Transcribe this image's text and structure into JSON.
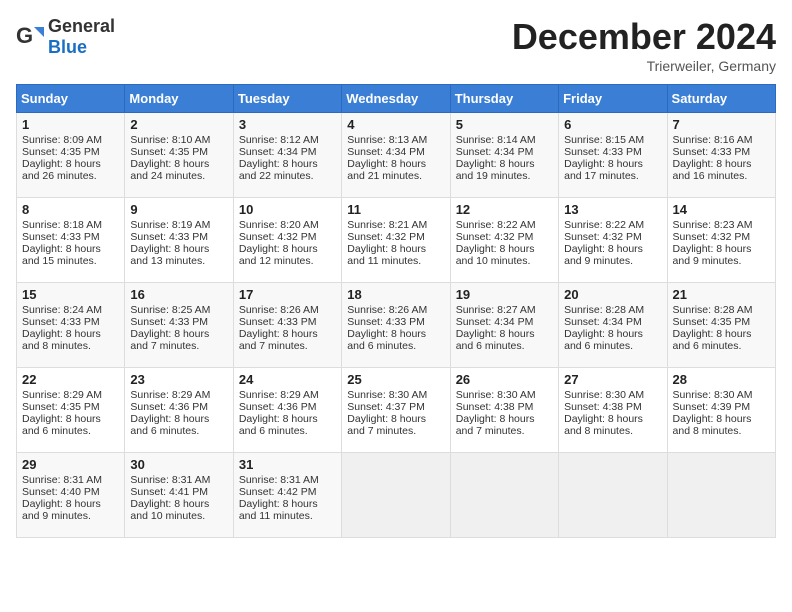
{
  "header": {
    "logo_general": "General",
    "logo_blue": "Blue",
    "month_title": "December 2024",
    "location": "Trierweiler, Germany"
  },
  "days_of_week": [
    "Sunday",
    "Monday",
    "Tuesday",
    "Wednesday",
    "Thursday",
    "Friday",
    "Saturday"
  ],
  "weeks": [
    [
      {
        "day": "1",
        "sunrise": "Sunrise: 8:09 AM",
        "sunset": "Sunset: 4:35 PM",
        "daylight": "Daylight: 8 hours and 26 minutes."
      },
      {
        "day": "2",
        "sunrise": "Sunrise: 8:10 AM",
        "sunset": "Sunset: 4:35 PM",
        "daylight": "Daylight: 8 hours and 24 minutes."
      },
      {
        "day": "3",
        "sunrise": "Sunrise: 8:12 AM",
        "sunset": "Sunset: 4:34 PM",
        "daylight": "Daylight: 8 hours and 22 minutes."
      },
      {
        "day": "4",
        "sunrise": "Sunrise: 8:13 AM",
        "sunset": "Sunset: 4:34 PM",
        "daylight": "Daylight: 8 hours and 21 minutes."
      },
      {
        "day": "5",
        "sunrise": "Sunrise: 8:14 AM",
        "sunset": "Sunset: 4:34 PM",
        "daylight": "Daylight: 8 hours and 19 minutes."
      },
      {
        "day": "6",
        "sunrise": "Sunrise: 8:15 AM",
        "sunset": "Sunset: 4:33 PM",
        "daylight": "Daylight: 8 hours and 17 minutes."
      },
      {
        "day": "7",
        "sunrise": "Sunrise: 8:16 AM",
        "sunset": "Sunset: 4:33 PM",
        "daylight": "Daylight: 8 hours and 16 minutes."
      }
    ],
    [
      {
        "day": "8",
        "sunrise": "Sunrise: 8:18 AM",
        "sunset": "Sunset: 4:33 PM",
        "daylight": "Daylight: 8 hours and 15 minutes."
      },
      {
        "day": "9",
        "sunrise": "Sunrise: 8:19 AM",
        "sunset": "Sunset: 4:33 PM",
        "daylight": "Daylight: 8 hours and 13 minutes."
      },
      {
        "day": "10",
        "sunrise": "Sunrise: 8:20 AM",
        "sunset": "Sunset: 4:32 PM",
        "daylight": "Daylight: 8 hours and 12 minutes."
      },
      {
        "day": "11",
        "sunrise": "Sunrise: 8:21 AM",
        "sunset": "Sunset: 4:32 PM",
        "daylight": "Daylight: 8 hours and 11 minutes."
      },
      {
        "day": "12",
        "sunrise": "Sunrise: 8:22 AM",
        "sunset": "Sunset: 4:32 PM",
        "daylight": "Daylight: 8 hours and 10 minutes."
      },
      {
        "day": "13",
        "sunrise": "Sunrise: 8:22 AM",
        "sunset": "Sunset: 4:32 PM",
        "daylight": "Daylight: 8 hours and 9 minutes."
      },
      {
        "day": "14",
        "sunrise": "Sunrise: 8:23 AM",
        "sunset": "Sunset: 4:32 PM",
        "daylight": "Daylight: 8 hours and 9 minutes."
      }
    ],
    [
      {
        "day": "15",
        "sunrise": "Sunrise: 8:24 AM",
        "sunset": "Sunset: 4:33 PM",
        "daylight": "Daylight: 8 hours and 8 minutes."
      },
      {
        "day": "16",
        "sunrise": "Sunrise: 8:25 AM",
        "sunset": "Sunset: 4:33 PM",
        "daylight": "Daylight: 8 hours and 7 minutes."
      },
      {
        "day": "17",
        "sunrise": "Sunrise: 8:26 AM",
        "sunset": "Sunset: 4:33 PM",
        "daylight": "Daylight: 8 hours and 7 minutes."
      },
      {
        "day": "18",
        "sunrise": "Sunrise: 8:26 AM",
        "sunset": "Sunset: 4:33 PM",
        "daylight": "Daylight: 8 hours and 6 minutes."
      },
      {
        "day": "19",
        "sunrise": "Sunrise: 8:27 AM",
        "sunset": "Sunset: 4:34 PM",
        "daylight": "Daylight: 8 hours and 6 minutes."
      },
      {
        "day": "20",
        "sunrise": "Sunrise: 8:28 AM",
        "sunset": "Sunset: 4:34 PM",
        "daylight": "Daylight: 8 hours and 6 minutes."
      },
      {
        "day": "21",
        "sunrise": "Sunrise: 8:28 AM",
        "sunset": "Sunset: 4:35 PM",
        "daylight": "Daylight: 8 hours and 6 minutes."
      }
    ],
    [
      {
        "day": "22",
        "sunrise": "Sunrise: 8:29 AM",
        "sunset": "Sunset: 4:35 PM",
        "daylight": "Daylight: 8 hours and 6 minutes."
      },
      {
        "day": "23",
        "sunrise": "Sunrise: 8:29 AM",
        "sunset": "Sunset: 4:36 PM",
        "daylight": "Daylight: 8 hours and 6 minutes."
      },
      {
        "day": "24",
        "sunrise": "Sunrise: 8:29 AM",
        "sunset": "Sunset: 4:36 PM",
        "daylight": "Daylight: 8 hours and 6 minutes."
      },
      {
        "day": "25",
        "sunrise": "Sunrise: 8:30 AM",
        "sunset": "Sunset: 4:37 PM",
        "daylight": "Daylight: 8 hours and 7 minutes."
      },
      {
        "day": "26",
        "sunrise": "Sunrise: 8:30 AM",
        "sunset": "Sunset: 4:38 PM",
        "daylight": "Daylight: 8 hours and 7 minutes."
      },
      {
        "day": "27",
        "sunrise": "Sunrise: 8:30 AM",
        "sunset": "Sunset: 4:38 PM",
        "daylight": "Daylight: 8 hours and 8 minutes."
      },
      {
        "day": "28",
        "sunrise": "Sunrise: 8:30 AM",
        "sunset": "Sunset: 4:39 PM",
        "daylight": "Daylight: 8 hours and 8 minutes."
      }
    ],
    [
      {
        "day": "29",
        "sunrise": "Sunrise: 8:31 AM",
        "sunset": "Sunset: 4:40 PM",
        "daylight": "Daylight: 8 hours and 9 minutes."
      },
      {
        "day": "30",
        "sunrise": "Sunrise: 8:31 AM",
        "sunset": "Sunset: 4:41 PM",
        "daylight": "Daylight: 8 hours and 10 minutes."
      },
      {
        "day": "31",
        "sunrise": "Sunrise: 8:31 AM",
        "sunset": "Sunset: 4:42 PM",
        "daylight": "Daylight: 8 hours and 11 minutes."
      },
      null,
      null,
      null,
      null
    ]
  ]
}
